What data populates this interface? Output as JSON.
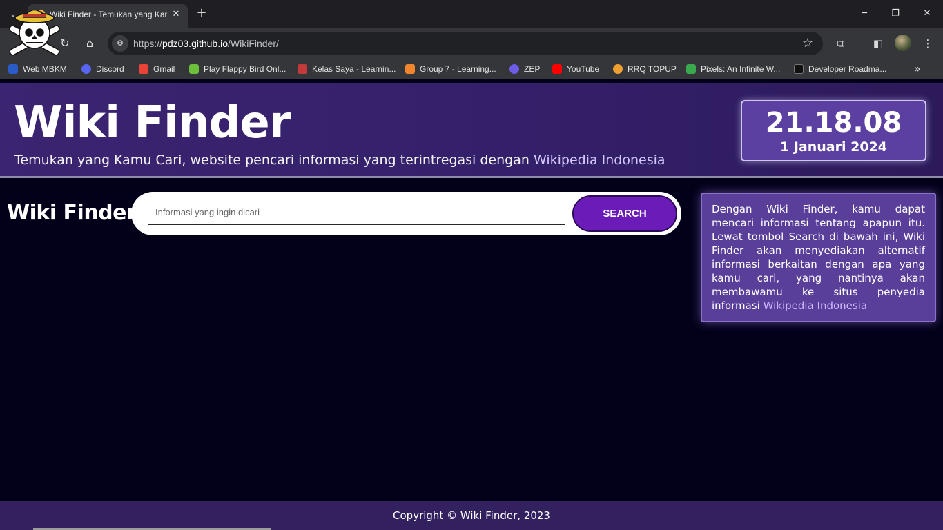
{
  "browser": {
    "tab_title": "Wiki Finder - Temukan yang Kamu Cari",
    "url_scheme": "https://",
    "url_host": "pdz03.github.io",
    "url_path": "/WikiFinder/",
    "bookmarks": [
      {
        "label": "Web MBKM",
        "color": "#2a5cc8"
      },
      {
        "label": "Discord",
        "color": "#5865f2"
      },
      {
        "label": "Gmail",
        "color": "#ea4335"
      },
      {
        "label": "Play Flappy Bird Onl...",
        "color": "#6bbf3a"
      },
      {
        "label": "Kelas Saya - Learnin...",
        "color": "#c23a3a"
      },
      {
        "label": "Group 7 - Learning...",
        "color": "#f0852d"
      },
      {
        "label": "ZEP",
        "color": "#6c5ce7"
      },
      {
        "label": "YouTube",
        "color": "#ff0000"
      },
      {
        "label": "RRQ TOPUP",
        "color": "#f0a030"
      },
      {
        "label": "Pixels: An Infinite W...",
        "color": "#3aa84c"
      },
      {
        "label": "Developer Roadma...",
        "color": "#111111"
      }
    ]
  },
  "header": {
    "title": "Wiki Finder",
    "subtitle_prefix": "Temukan yang Kamu Cari, website pencari informasi yang terintregasi dengan ",
    "subtitle_link": "Wikipedia Indonesia",
    "clock_time": "21.18.08",
    "clock_date": "1 Januari 2024"
  },
  "main": {
    "brand": "Wiki Finder",
    "search_placeholder": "Informasi yang ingin dicari",
    "search_button": "SEARCH",
    "info_text": "Dengan Wiki Finder, kamu dapat mencari informasi tentang apapun itu. Lewat tombol Search di bawah ini, Wiki Finder akan menyediakan alternatif informasi berkaitan dengan apa yang kamu cari, yang nantinya akan membawamu ke situs penyedia informasi ",
    "info_link": "Wikipedia Indonesia"
  },
  "footer": {
    "copyright": "Copyright © Wiki Finder, 2023"
  },
  "colors": {
    "header_bg": "#3b2471",
    "page_bg": "#03001a",
    "accent_button": "#6a1bb8",
    "box_bg": "#5b3fa1"
  }
}
